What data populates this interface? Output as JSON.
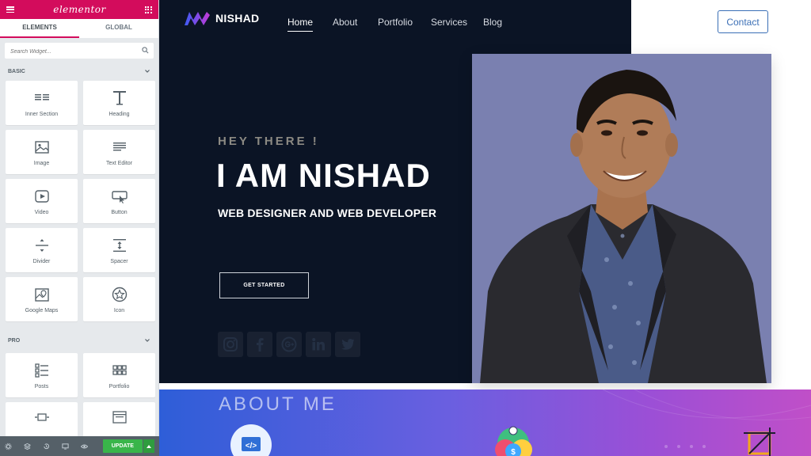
{
  "editor": {
    "logo": "elementor",
    "tabs": [
      "ELEMENTS",
      "GLOBAL"
    ],
    "search_placeholder": "Search Widget...",
    "categories": {
      "basic": "BASIC",
      "pro": "PRO"
    },
    "basic_widgets": [
      {
        "label": "Inner Section",
        "icon": "inner-section-icon"
      },
      {
        "label": "Heading",
        "icon": "heading-icon"
      },
      {
        "label": "Image",
        "icon": "image-icon"
      },
      {
        "label": "Text Editor",
        "icon": "text-editor-icon"
      },
      {
        "label": "Video",
        "icon": "video-icon"
      },
      {
        "label": "Button",
        "icon": "button-icon"
      },
      {
        "label": "Divider",
        "icon": "divider-icon"
      },
      {
        "label": "Spacer",
        "icon": "spacer-icon"
      },
      {
        "label": "Google Maps",
        "icon": "google-maps-icon"
      },
      {
        "label": "Icon",
        "icon": "star-icon"
      }
    ],
    "pro_widgets": [
      {
        "label": "Posts",
        "icon": "posts-icon"
      },
      {
        "label": "Portfolio",
        "icon": "portfolio-icon"
      },
      {
        "label": "",
        "icon": "slides-icon"
      },
      {
        "label": "",
        "icon": "form-icon"
      }
    ],
    "footer": {
      "update_label": "UPDATE"
    },
    "colors": {
      "accent": "#d30c5c",
      "update": "#39b54a"
    }
  },
  "site": {
    "brand": "NISHAD",
    "nav": [
      "Home",
      "About",
      "Portfolio",
      "Services",
      "Blog"
    ],
    "contact_label": "Contact",
    "hero": {
      "greeting": "HEY THERE !",
      "headline": "I AM NISHAD",
      "subheadline": "WEB DESIGNER AND WEB DEVELOPER",
      "cta_label": "GET STARTED"
    },
    "socials": [
      "instagram-icon",
      "facebook-icon",
      "google-plus-icon",
      "linkedin-icon",
      "twitter-icon"
    ],
    "about_title": "ABOUT ME",
    "colors": {
      "hero_bg": "#0b1425",
      "photo_bg": "#7a80b0",
      "contact": "#3b6fb6"
    }
  }
}
